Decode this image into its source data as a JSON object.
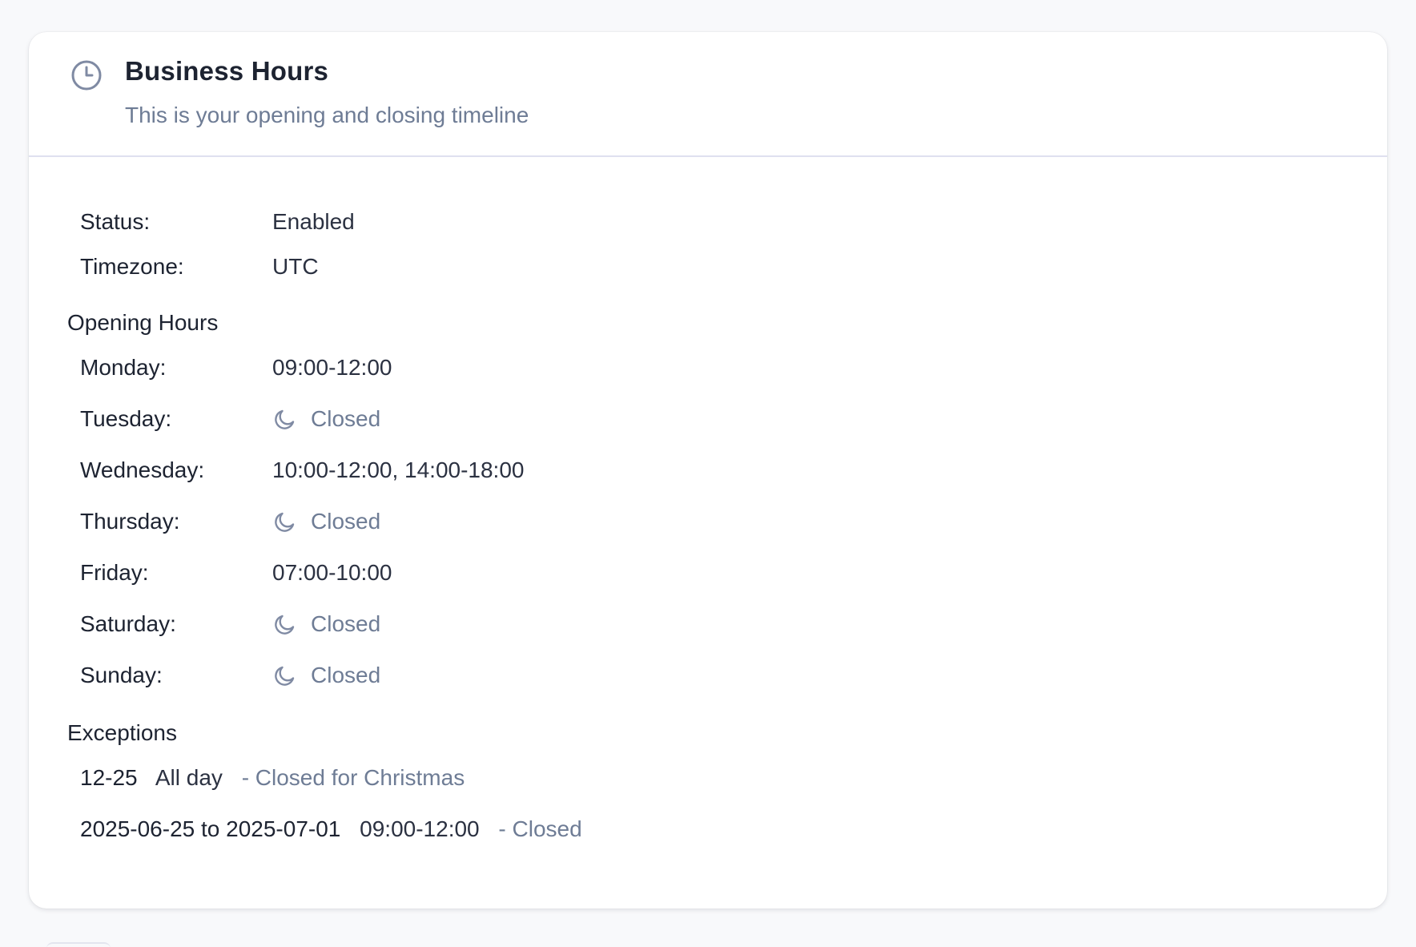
{
  "header": {
    "title": "Business Hours",
    "subtitle": "This is your opening and closing timeline",
    "icon": "clock-icon"
  },
  "status": {
    "label": "Status:",
    "value": "Enabled"
  },
  "timezone": {
    "label": "Timezone:",
    "value": "UTC"
  },
  "opening_hours": {
    "title": "Opening Hours",
    "days": [
      {
        "label": "Monday:",
        "value": "09:00-12:00",
        "closed": false
      },
      {
        "label": "Tuesday:",
        "value": "Closed",
        "closed": true
      },
      {
        "label": "Wednesday:",
        "value": "10:00-12:00, 14:00-18:00",
        "closed": false
      },
      {
        "label": "Thursday:",
        "value": "Closed",
        "closed": true
      },
      {
        "label": "Friday:",
        "value": "07:00-10:00",
        "closed": false
      },
      {
        "label": "Saturday:",
        "value": "Closed",
        "closed": true
      },
      {
        "label": "Sunday:",
        "value": "Closed",
        "closed": true
      }
    ]
  },
  "exceptions": {
    "title": "Exceptions",
    "items": [
      {
        "date": "12-25",
        "time": "All day",
        "note": "- Closed for Christmas"
      },
      {
        "date": "2025-06-25 to 2025-07-01",
        "time": "09:00-12:00",
        "note": "- Closed"
      }
    ]
  },
  "colors": {
    "muted_text": "#6e7c95",
    "primary_text": "#1d2331",
    "divider": "#dfe0f0",
    "card_bg": "#ffffff"
  }
}
